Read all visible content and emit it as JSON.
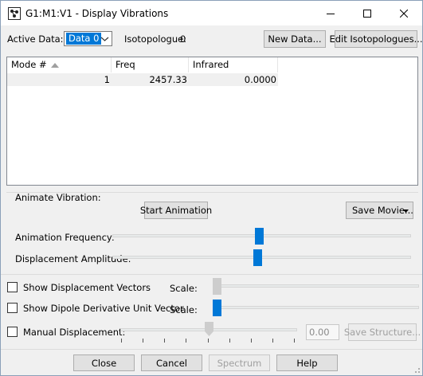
{
  "window": {
    "title": "G1:M1:V1 - Display Vibrations",
    "buttons": {
      "minimize_icon": "minimize-icon",
      "maximize_icon": "maximize-icon",
      "close_icon": "close-icon"
    }
  },
  "top": {
    "active_data_label": "Active Data:",
    "active_data_value": "Data 0",
    "isotopologue_label": "Isotopologue:",
    "isotopologue_value": "0",
    "new_data_button": "New Data...",
    "edit_isotopologues_button": "Edit Isotopologues..."
  },
  "table": {
    "columns": [
      "Mode #",
      "Freq",
      "Infrared"
    ],
    "rows": [
      {
        "mode": "1",
        "freq": "2457.33",
        "infrared": "0.0000"
      }
    ]
  },
  "animate": {
    "group_label": "Animate Vibration:",
    "start_button": "Start Animation",
    "save_movie_button": "Save Movie...",
    "frequency_label": "Animation Frequency:",
    "amplitude_label": "Displacement Amplitude:"
  },
  "options": {
    "displacement_vectors_label": "Show Displacement Vectors",
    "dipole_vector_label": "Show Dipole Derivative Unit Vector",
    "scale_label": "Scale:",
    "manual_displacement_label": "Manual Displacement:",
    "manual_value": "0.00",
    "save_structure_button": "Save Structure..."
  },
  "bottom": {
    "close_button": "Close",
    "cancel_button": "Cancel",
    "spectrum_button": "Spectrum",
    "help_button": "Help"
  },
  "colors": {
    "accent": "#0078d7",
    "title_bg": "#ffffff",
    "dialog_bg": "#f0f0f0"
  }
}
